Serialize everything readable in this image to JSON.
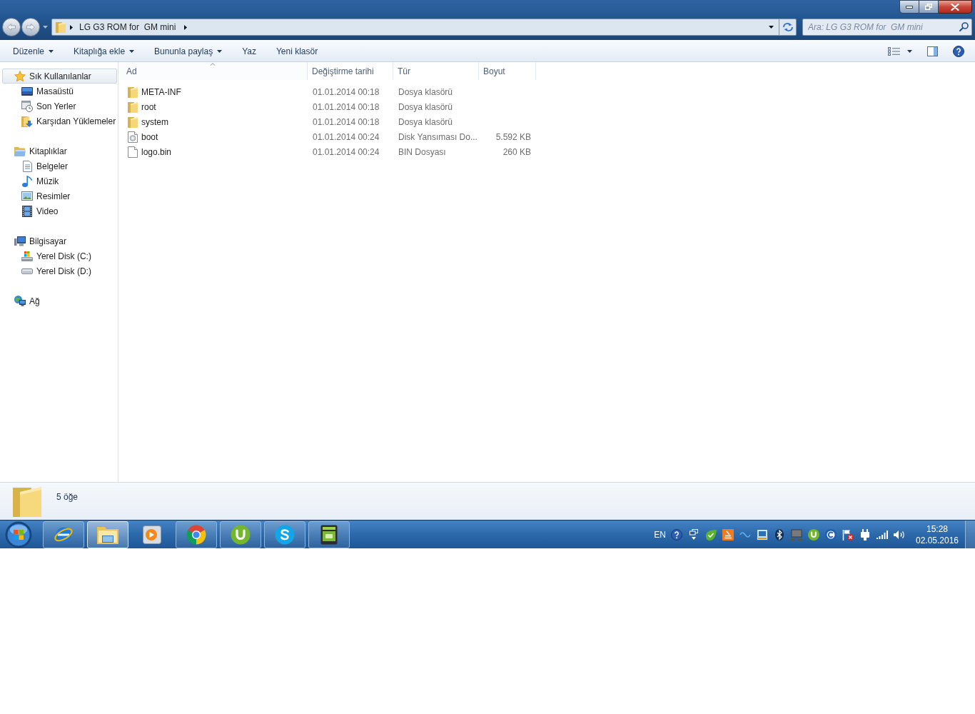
{
  "navigation": {
    "back": {
      "disabled": true
    },
    "forward": {
      "disabled": true
    }
  },
  "address_bar": {
    "path": [
      "LG G3 ROM for  GM mini"
    ]
  },
  "search": {
    "placeholder": "Ara: LG G3 ROM for  GM mini"
  },
  "toolbar": {
    "items": [
      {
        "label": "Düzenle",
        "kind": "menu"
      },
      {
        "label": "Kitaplığa ekle",
        "kind": "menu"
      },
      {
        "label": "Bununla paylaş",
        "kind": "menu"
      },
      {
        "label": "Yaz",
        "kind": "command"
      },
      {
        "label": "Yeni klasör",
        "kind": "command"
      }
    ]
  },
  "sidebar": {
    "groups": [
      {
        "label": "Sık Kullanılanlar",
        "selected": true,
        "children": [
          {
            "label": "Masaüstü",
            "selected": false
          },
          {
            "label": "Son Yerler",
            "selected": false
          },
          {
            "label": "Karşıdan Yüklemeler",
            "selected": false
          }
        ]
      },
      {
        "label": "Kitaplıklar",
        "selected": false,
        "children": [
          {
            "label": "Belgeler",
            "selected": false
          },
          {
            "label": "Müzik",
            "selected": false
          },
          {
            "label": "Resimler",
            "selected": false
          },
          {
            "label": "Video",
            "selected": false
          }
        ]
      },
      {
        "label": "Bilgisayar",
        "selected": false,
        "children": [
          {
            "label": "Yerel Disk (C:)",
            "selected": false
          },
          {
            "label": "Yerel Disk (D:)",
            "selected": false
          }
        ]
      },
      {
        "label": "Ağ",
        "selected": false
      }
    ]
  },
  "file_list": {
    "columns": [
      {
        "label": "Ad",
        "sorted": true
      },
      {
        "label": "Değiştirme tarihi",
        "sorted": false
      },
      {
        "label": "Tür",
        "sorted": false
      },
      {
        "label": "Boyut",
        "sorted": false
      }
    ],
    "rows": [
      {
        "kind": "folder",
        "name": "META-INF",
        "modified": "01.01.2014 00:18",
        "type": "Dosya klasörü"
      },
      {
        "kind": "folder",
        "name": "root",
        "modified": "01.01.2014 00:18",
        "type": "Dosya klasörü"
      },
      {
        "kind": "folder",
        "name": "system",
        "modified": "01.01.2014 00:18",
        "type": "Dosya klasörü"
      },
      {
        "kind": "disk_image",
        "name": "boot",
        "modified": "01.01.2014 00:24",
        "type": "Disk Yansıması Do...",
        "size": "5.592 KB"
      },
      {
        "kind": "file",
        "name": "logo.bin",
        "modified": "01.01.2014 00:24",
        "type": "BIN Dosyası",
        "size": "260 KB"
      }
    ]
  },
  "details_pane": {
    "item_count": "5 öğe"
  },
  "taskbar": {
    "apps": [
      {
        "running": true,
        "selected": false
      },
      {
        "running": true,
        "selected": true
      },
      {
        "running": false,
        "selected": false
      },
      {
        "running": true,
        "selected": false
      },
      {
        "running": true,
        "selected": false
      },
      {
        "running": true,
        "selected": false
      },
      {
        "running": true,
        "selected": false
      }
    ],
    "tray": {
      "language": "EN",
      "time": "15:28",
      "date": "02.05.2016"
    }
  }
}
